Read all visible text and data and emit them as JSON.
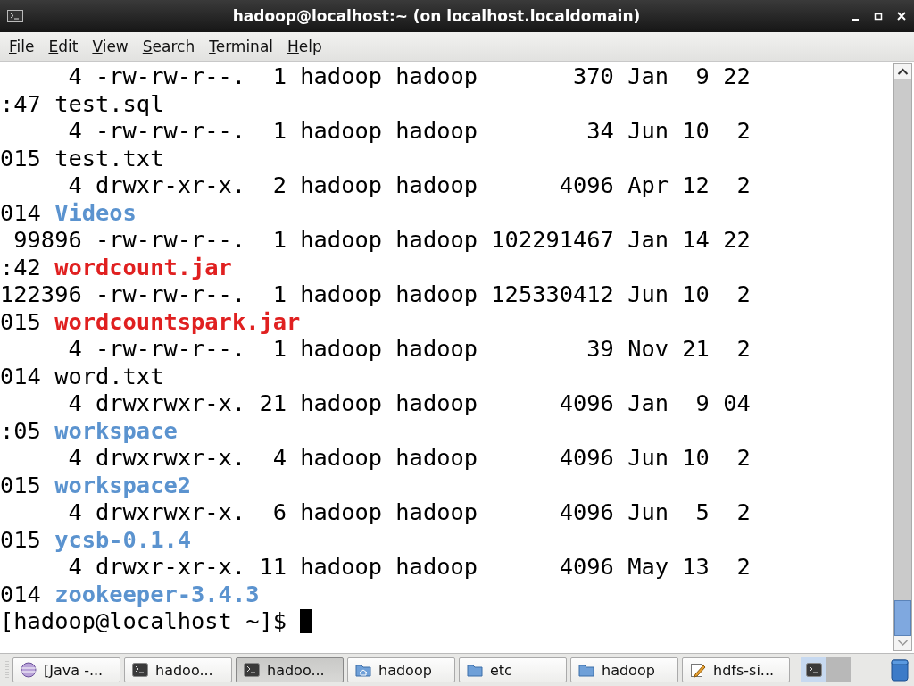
{
  "window": {
    "title": "hadoop@localhost:~ (on localhost.localdomain)"
  },
  "menu": [
    {
      "label": "File"
    },
    {
      "label": "Edit"
    },
    {
      "label": "View"
    },
    {
      "label": "Search"
    },
    {
      "label": "Terminal"
    },
    {
      "label": "Help"
    }
  ],
  "terminal": {
    "lines": [
      {
        "text": "     4 -rw-rw-r--.  1 hadoop hadoop       370 Jan  9 22"
      },
      {
        "text": ":47 ",
        "name": "test.sql",
        "kind": "plain"
      },
      {
        "text": "     4 -rw-rw-r--.  1 hadoop hadoop        34 Jun 10  2"
      },
      {
        "text": "015 ",
        "name": "test.txt",
        "kind": "plain"
      },
      {
        "text": "     4 drwxr-xr-x.  2 hadoop hadoop      4096 Apr 12  2"
      },
      {
        "text": "014 ",
        "name": "Videos",
        "kind": "dir"
      },
      {
        "text": " 99896 -rw-rw-r--.  1 hadoop hadoop 102291467 Jan 14 22"
      },
      {
        "text": ":42 ",
        "name": "wordcount.jar",
        "kind": "archive"
      },
      {
        "text": "122396 -rw-rw-r--.  1 hadoop hadoop 125330412 Jun 10  2"
      },
      {
        "text": "015 ",
        "name": "wordcountspark.jar",
        "kind": "archive"
      },
      {
        "text": "     4 -rw-rw-r--.  1 hadoop hadoop        39 Nov 21  2"
      },
      {
        "text": "014 ",
        "name": "word.txt",
        "kind": "plain"
      },
      {
        "text": "     4 drwxrwxr-x. 21 hadoop hadoop      4096 Jan  9 04"
      },
      {
        "text": ":05 ",
        "name": "workspace",
        "kind": "dir"
      },
      {
        "text": "     4 drwxrwxr-x.  4 hadoop hadoop      4096 Jun 10  2"
      },
      {
        "text": "015 ",
        "name": "workspace2",
        "kind": "dir"
      },
      {
        "text": "     4 drwxrwxr-x.  6 hadoop hadoop      4096 Jun  5  2"
      },
      {
        "text": "015 ",
        "name": "ycsb-0.1.4",
        "kind": "dir"
      },
      {
        "text": "     4 drwxr-xr-x. 11 hadoop hadoop      4096 May 13  2"
      },
      {
        "text": "014 ",
        "name": "zookeeper-3.4.3",
        "kind": "dir"
      }
    ],
    "prompt": "[hadoop@localhost ~]$ "
  },
  "taskbar": [
    {
      "label": "[Java -...",
      "kind": "globe",
      "selected": false
    },
    {
      "label": "hadoo...",
      "kind": "terminal",
      "selected": false
    },
    {
      "label": "hadoo...",
      "kind": "terminal",
      "selected": true
    },
    {
      "label": "hadoop",
      "kind": "home",
      "selected": false
    },
    {
      "label": "etc",
      "kind": "folder",
      "selected": false
    },
    {
      "label": "hadoop",
      "kind": "folder",
      "selected": false
    },
    {
      "label": "hdfs-si...",
      "kind": "editor",
      "selected": false
    }
  ]
}
